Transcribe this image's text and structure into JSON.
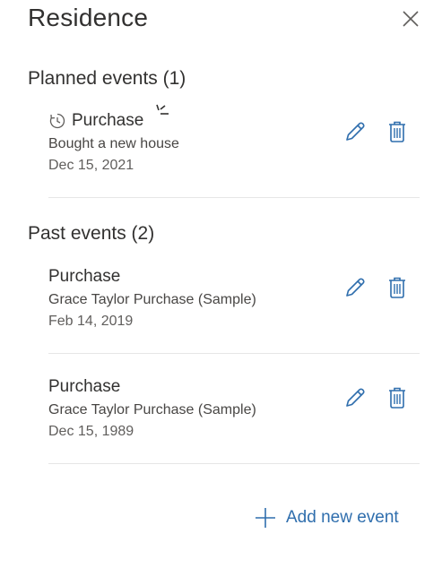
{
  "panel": {
    "title": "Residence"
  },
  "planned": {
    "heading": "Planned events (1)",
    "events": [
      {
        "title": "Purchase",
        "description": "Bought a new house",
        "date": "Dec 15, 2021"
      }
    ]
  },
  "past": {
    "heading": "Past events (2)",
    "events": [
      {
        "title": "Purchase",
        "description": "Grace Taylor Purchase (Sample)",
        "date": "Feb 14, 2019"
      },
      {
        "title": "Purchase",
        "description": "Grace Taylor Purchase (Sample)",
        "date": "Dec 15, 1989"
      }
    ]
  },
  "actions": {
    "add_label": "Add new event"
  },
  "icons": {
    "close": "close-icon",
    "planned_clock": "clock-icon",
    "edit": "pencil-icon",
    "delete": "trash-icon",
    "add": "plus-icon"
  },
  "colors": {
    "accent": "#2f6ead",
    "text": "#323130",
    "divider": "#e6e6e6"
  }
}
